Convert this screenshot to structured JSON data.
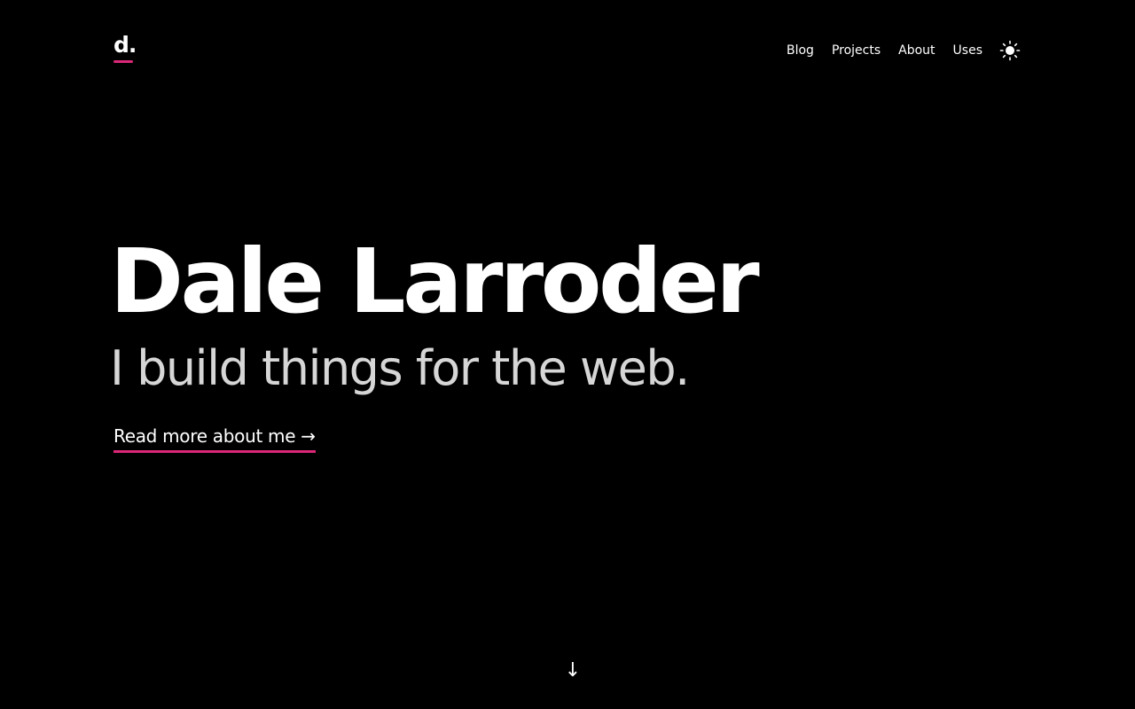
{
  "header": {
    "logo_text": "d.",
    "nav": [
      {
        "label": "Blog"
      },
      {
        "label": "Projects"
      },
      {
        "label": "About"
      },
      {
        "label": "Uses"
      }
    ],
    "theme_toggle_icon": "sun-icon"
  },
  "hero": {
    "name": "Dale Larroder",
    "tagline": "I build things for the web.",
    "cta_label": "Read more about me →"
  },
  "scroll_arrow": "↓",
  "colors": {
    "background": "#000000",
    "accent": "#db2777",
    "text": "#ffffff",
    "tagline": "#d6d6d6"
  }
}
